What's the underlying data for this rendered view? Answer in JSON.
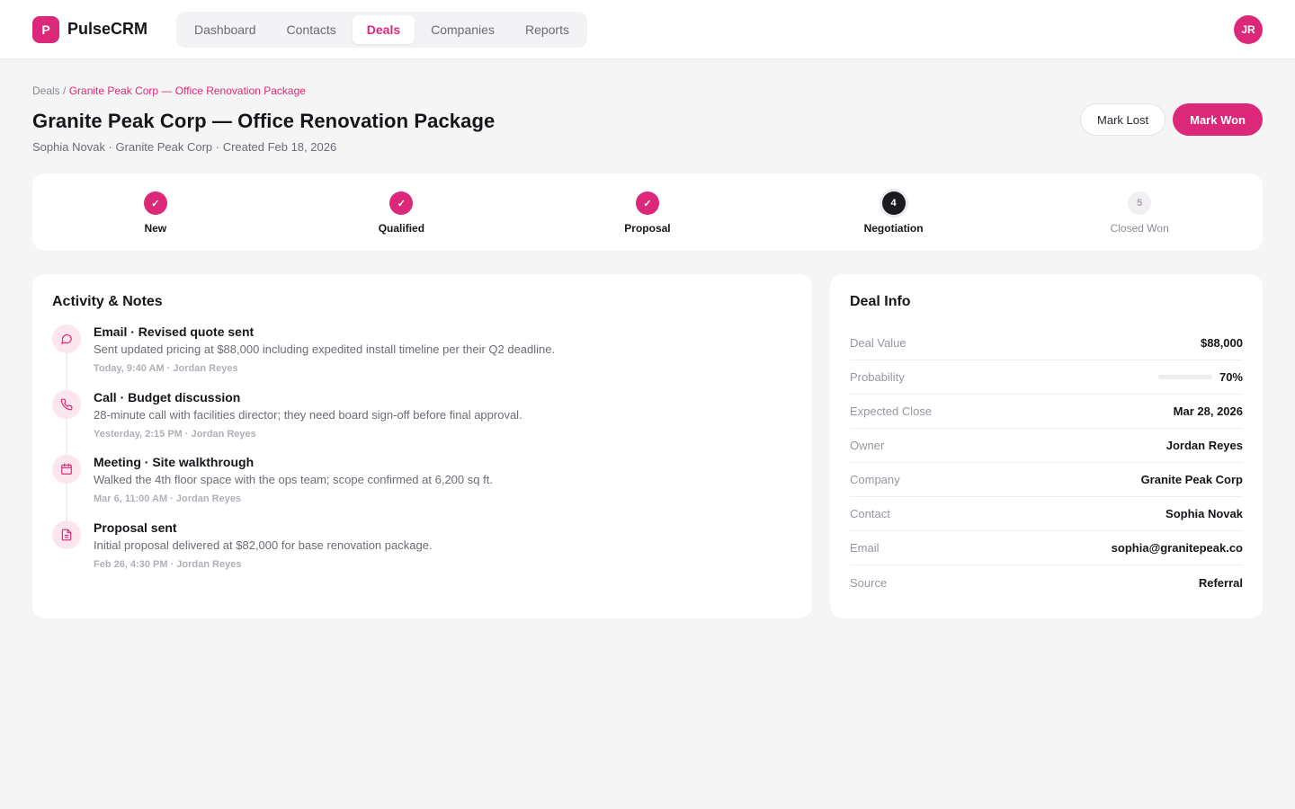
{
  "brand": {
    "logo_letter": "P",
    "name": "PulseCRM"
  },
  "nav": {
    "items": [
      {
        "label": "Dashboard",
        "active": false
      },
      {
        "label": "Contacts",
        "active": false
      },
      {
        "label": "Deals",
        "active": true
      },
      {
        "label": "Companies",
        "active": false
      },
      {
        "label": "Reports",
        "active": false
      }
    ]
  },
  "user": {
    "initials": "JR"
  },
  "breadcrumb": {
    "parent": "Deals",
    "separator": " / ",
    "current": "Granite Peak Corp — Office Renovation Package"
  },
  "deal": {
    "title": "Granite Peak Corp — Office Renovation Package",
    "subtitle": "Sophia Novak · Granite Peak Corp · Created Feb 18, 2026"
  },
  "actions": {
    "mark_lost": "Mark Lost",
    "mark_won": "Mark Won"
  },
  "stages": [
    {
      "label": "New",
      "status": "done",
      "marker": "✓"
    },
    {
      "label": "Qualified",
      "status": "done",
      "marker": "✓"
    },
    {
      "label": "Proposal",
      "status": "done",
      "marker": "✓"
    },
    {
      "label": "Negotiation",
      "status": "current",
      "marker": "4"
    },
    {
      "label": "Closed Won",
      "status": "todo",
      "marker": "5"
    }
  ],
  "activity": {
    "title": "Activity & Notes",
    "items": [
      {
        "icon": "chat-bubble-icon",
        "title": "Email · Revised quote sent",
        "text": "Sent updated pricing at $88,000 including expedited install timeline per their Q2 deadline.",
        "meta": "Today, 9:40 AM · Jordan Reyes"
      },
      {
        "icon": "phone-icon",
        "title": "Call · Budget discussion",
        "text": "28-minute call with facilities director; they need board sign-off before final approval.",
        "meta": "Yesterday, 2:15 PM · Jordan Reyes"
      },
      {
        "icon": "calendar-icon",
        "title": "Meeting · Site walkthrough",
        "text": "Walked the 4th floor space with the ops team; scope confirmed at 6,200 sq ft.",
        "meta": "Mar 6, 11:00 AM · Jordan Reyes"
      },
      {
        "icon": "document-icon",
        "title": "Proposal sent",
        "text": "Initial proposal delivered at $82,000 for base renovation package.",
        "meta": "Feb 26, 4:30 PM · Jordan Reyes"
      }
    ]
  },
  "deal_info": {
    "title": "Deal Info",
    "rows": [
      {
        "label": "Deal Value",
        "value": "$88,000"
      },
      {
        "label": "Probability",
        "value": "70%",
        "percent": 70
      },
      {
        "label": "Expected Close",
        "value": "Mar 28, 2026"
      },
      {
        "label": "Owner",
        "value": "Jordan Reyes"
      },
      {
        "label": "Company",
        "value": "Granite Peak Corp"
      },
      {
        "label": "Contact",
        "value": "Sophia Novak"
      },
      {
        "label": "Email",
        "value": "sophia@granitepeak.co"
      },
      {
        "label": "Source",
        "value": "Referral"
      }
    ]
  },
  "colors": {
    "accent": "#dc2878",
    "dark": "#1d1a20"
  }
}
